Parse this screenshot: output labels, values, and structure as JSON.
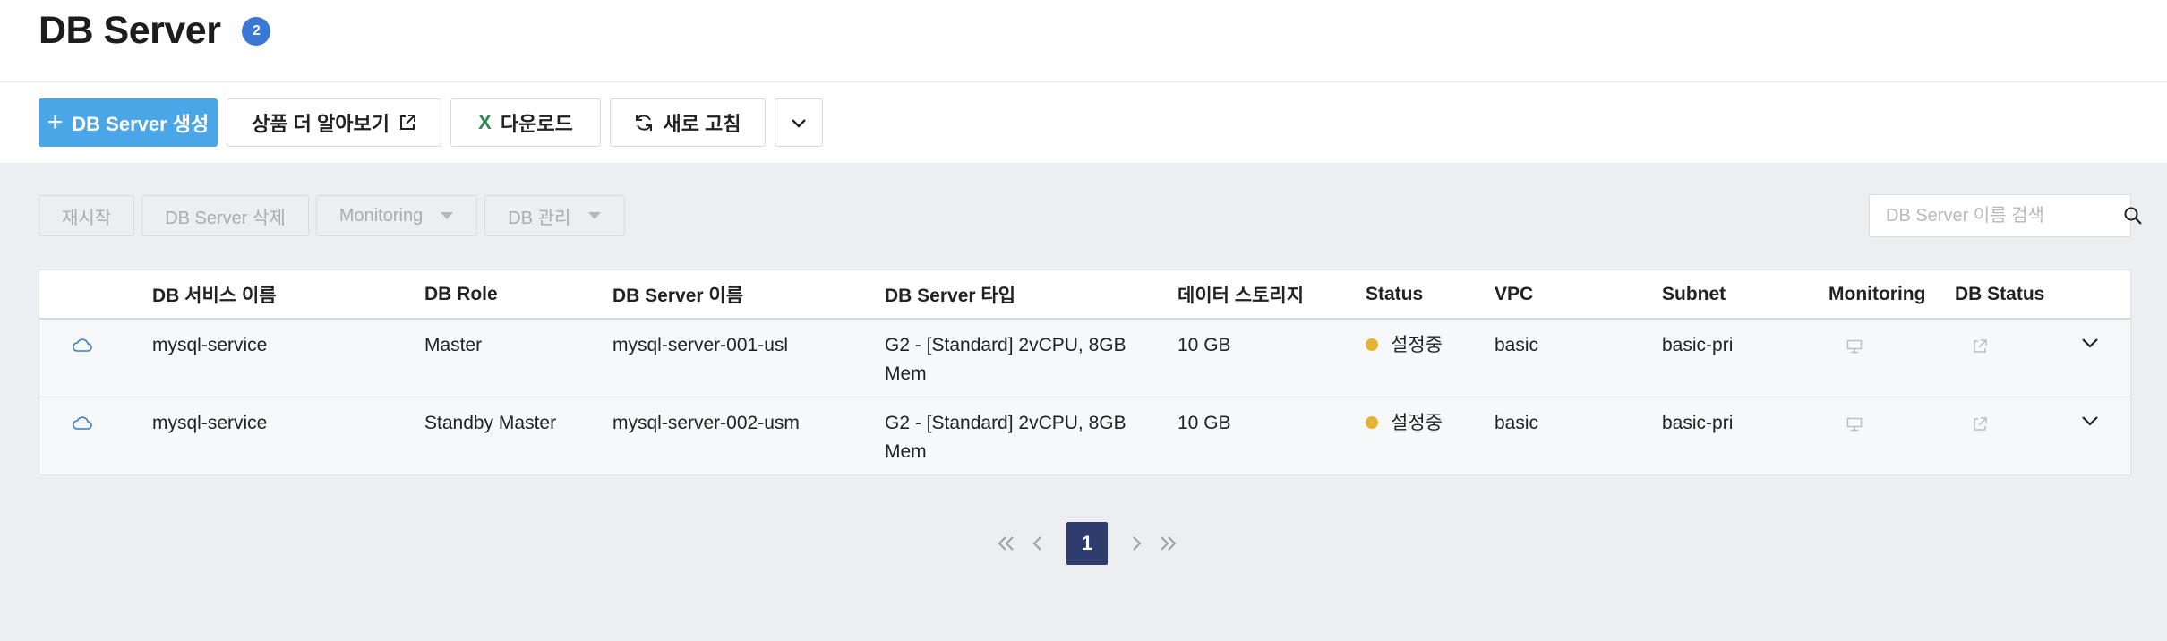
{
  "header": {
    "title": "DB Server",
    "count": "2"
  },
  "toolbar": {
    "create_label": "DB Server 생성",
    "learn_more_label": "상품 더 알아보기",
    "download_label": "다운로드",
    "refresh_label": "새로 고침"
  },
  "actions": {
    "restart_label": "재시작",
    "delete_label": "DB Server 삭제",
    "monitoring_label": "Monitoring",
    "db_manage_label": "DB 관리"
  },
  "search": {
    "placeholder": "DB Server 이름 검색"
  },
  "table": {
    "columns": [
      "DB 서비스 이름",
      "DB Role",
      "DB Server 이름",
      "DB Server 타입",
      "데이터 스토리지",
      "Status",
      "VPC",
      "Subnet",
      "Monitoring",
      "DB Status"
    ],
    "rows": [
      {
        "service": "mysql-service",
        "role": "Master",
        "server": "mysql-server-001-usl",
        "type": "G2 - [Standard] 2vCPU, 8GB Mem",
        "storage": "10 GB",
        "status": "설정중",
        "vpc": "basic",
        "subnet": "basic-pri"
      },
      {
        "service": "mysql-service",
        "role": "Standby Master",
        "server": "mysql-server-002-usm",
        "type": "G2 - [Standard] 2vCPU, 8GB Mem",
        "storage": "10 GB",
        "status": "설정중",
        "vpc": "basic",
        "subnet": "basic-pri"
      }
    ]
  },
  "pagination": {
    "current_page": "1"
  },
  "colors": {
    "primary": "#4aa6e6",
    "badge": "#3a78d4",
    "status_pending": "#e8b234",
    "pager_active": "#2e3c6e"
  },
  "icons": [
    "plus-icon",
    "external-link-icon",
    "excel-icon",
    "refresh-icon",
    "chevron-down-icon",
    "search-icon",
    "cloud-icon",
    "monitor-icon",
    "external-link-icon",
    "chevron-double-left-icon",
    "chevron-left-icon",
    "chevron-right-icon",
    "chevron-double-right-icon"
  ]
}
